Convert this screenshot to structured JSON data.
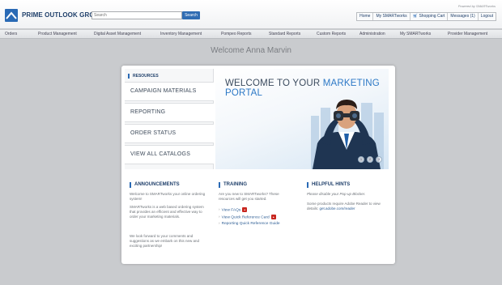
{
  "header": {
    "brand": "PRIME OUTLOOK GROUP",
    "search_placeholder": "Search",
    "search_button": "Search",
    "powered_by": "Powered by SMARTworks",
    "user_nav": [
      "Home",
      "My SMARTworks",
      "Shopping Cart",
      "Messages (1)",
      "Logout"
    ],
    "accent": "#2a6ab5"
  },
  "main_nav": [
    "Orders",
    "Product Management",
    "Digital Asset Management",
    "Inventory Management",
    "Pompeo Reports",
    "Standard Reports",
    "Custom Reports",
    "Administration",
    "My SMARTworks",
    "Provider Management"
  ],
  "welcome": "Welcome Anna Marvin",
  "resources": {
    "title": "RESOURCES",
    "links": [
      "CAMPAIGN MATERIALS",
      "REPORTING",
      "ORDER STATUS",
      "VIEW ALL CATALOGS"
    ]
  },
  "banner": {
    "title_line1_prefix": "WELCOME TO YOUR ",
    "title_line1_highlight": "MARKETING",
    "title_line2": "PORTAL",
    "dots": [
      "1",
      "2",
      "3"
    ]
  },
  "announcements": {
    "title": "ANNOUNCEMENTS",
    "p1": "Welcome to SMARTworks your online ordering system!",
    "p2": "SMARTworks is a web based ordering system that provides an efficient and effective way to order your marketing materials.",
    "p3": "We look forward to your comments and suggestions as we embark on this new and exciting partnership!"
  },
  "training": {
    "title": "TRAINING",
    "intro": "Are you new to SMARTworks? These resources will get you started.",
    "links": [
      "View FAQs",
      "View Quick Reference Card",
      "Reporting Quick Reference Guide"
    ]
  },
  "hints": {
    "title": "HELPFUL HINTS",
    "p1": "Please disable your Pop-up Blocker.",
    "p2_prefix": "Some products require Adobe Reader to view details:",
    "p2_link": "get.adobe.com/reader"
  }
}
